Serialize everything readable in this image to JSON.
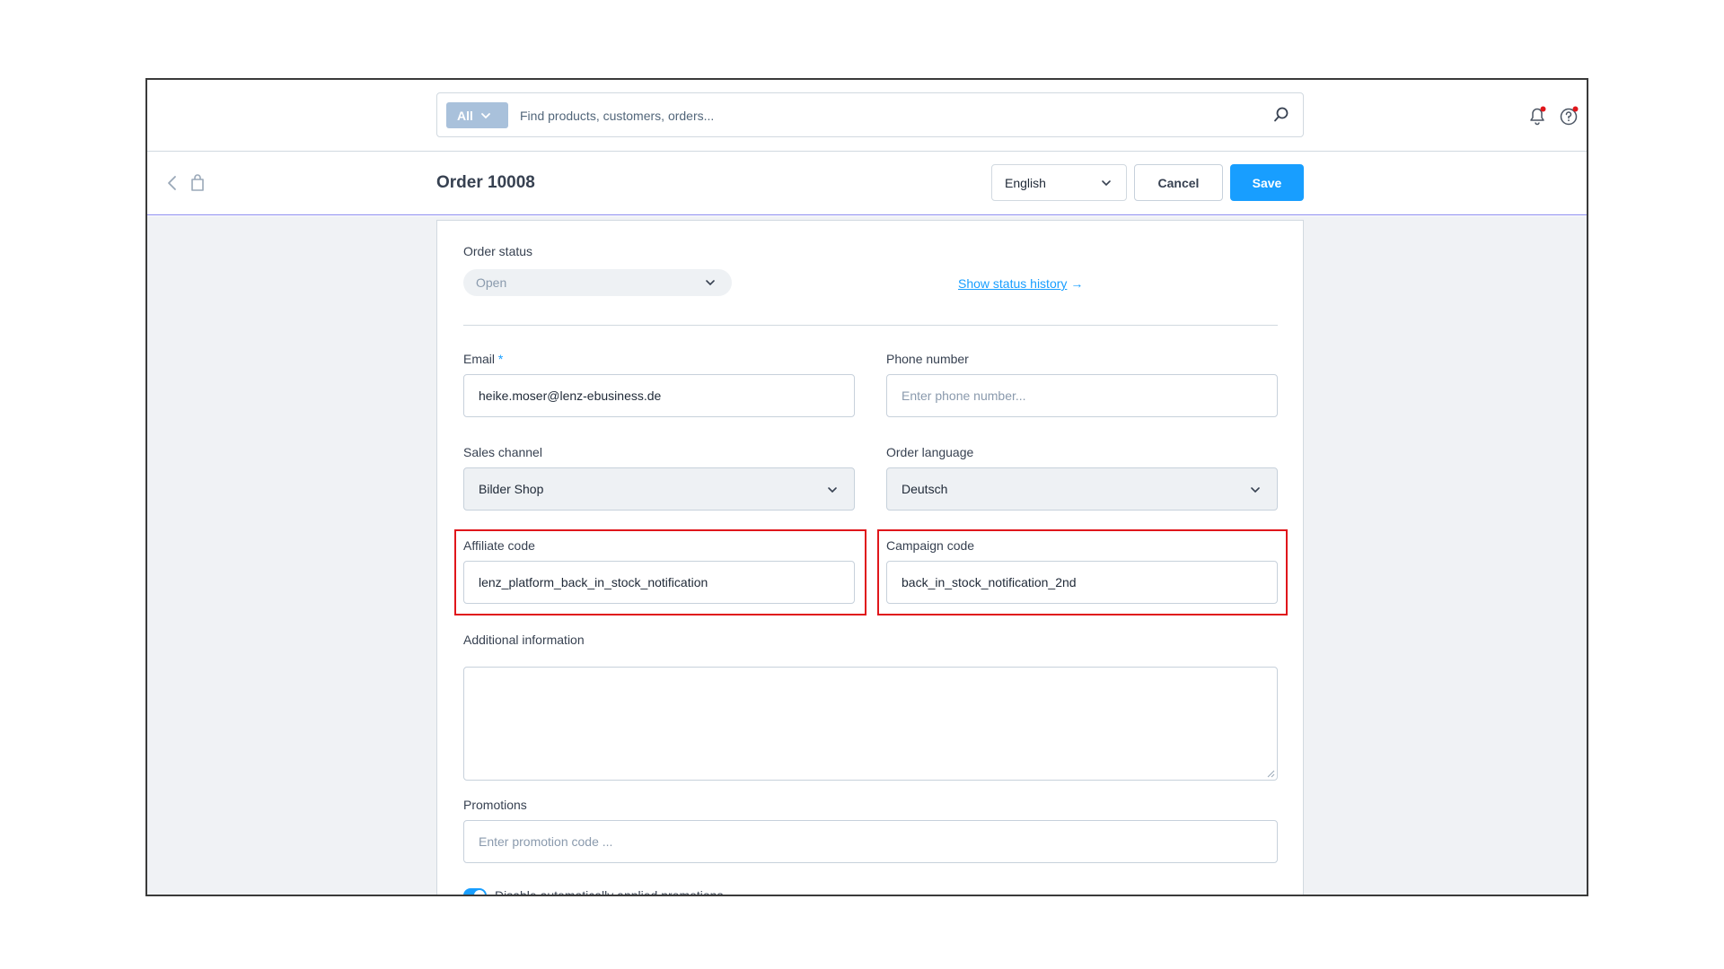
{
  "search": {
    "type_label": "All",
    "placeholder": "Find products, customers, orders..."
  },
  "header": {
    "title": "Order 10008",
    "language": "English",
    "cancel_label": "Cancel",
    "save_label": "Save"
  },
  "form": {
    "order_status": {
      "label": "Order status",
      "value": "Open",
      "history_link": "Show status history",
      "history_arrow": "→"
    },
    "email": {
      "label": "Email",
      "required_mark": "*",
      "value": "heike.moser@lenz-ebusiness.de"
    },
    "phone": {
      "label": "Phone number",
      "placeholder": "Enter phone number..."
    },
    "sales_channel": {
      "label": "Sales channel",
      "value": "Bilder Shop"
    },
    "order_language": {
      "label": "Order language",
      "value": "Deutsch"
    },
    "affiliate_code": {
      "label": "Affiliate code",
      "value": "lenz_platform_back_in_stock_notification"
    },
    "campaign_code": {
      "label": "Campaign code",
      "value": "back_in_stock_notification_2nd"
    },
    "additional_info": {
      "label": "Additional information"
    },
    "promotions": {
      "label": "Promotions",
      "placeholder": "Enter promotion code ..."
    },
    "disable_promotions": {
      "label": "Disable automatically applied promotions",
      "enabled": true
    }
  },
  "colors": {
    "accent": "#189eff",
    "highlight": "#e0161b",
    "header_border": "#8b8cf0"
  },
  "icons": [
    "chevron-down-icon",
    "search-icon",
    "bell-icon",
    "help-icon",
    "back-arrow-icon",
    "shopping-bag-icon"
  ]
}
